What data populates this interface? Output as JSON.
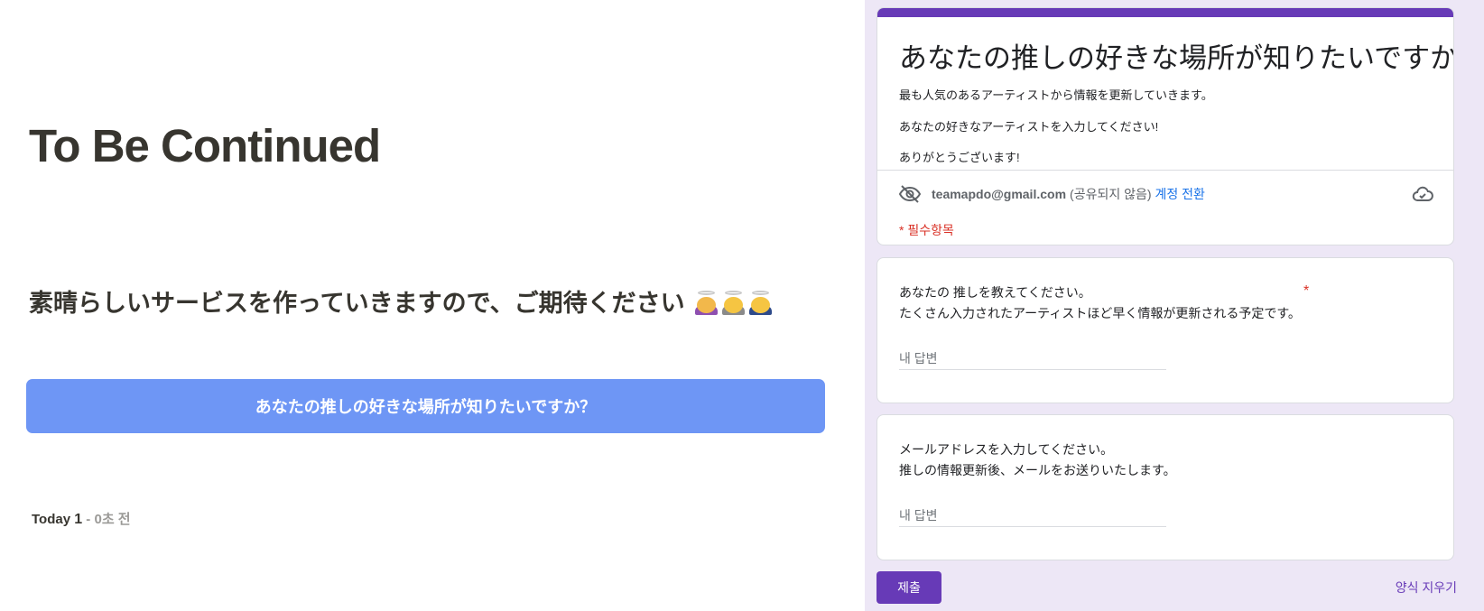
{
  "left": {
    "title": "To Be Continued",
    "subtitle": "素晴らしいサービスを作っていきますので、ご期待ください",
    "emojis": [
      "woman-pouting-icon",
      "person-bowing-icon",
      "man-bowing-icon"
    ],
    "cta_label": "あなたの推しの好きな場所が知りたいですか？",
    "counter": {
      "label": "Today",
      "count": "1",
      "sep": " - ",
      "elapsed": "0초 전"
    }
  },
  "form": {
    "accent_color": "#673ab7",
    "title": "あなたの推しの好きな場所が知りたいですか？",
    "description": [
      "最も人気のあるアーティストから情報を更新していきます。",
      "あなたの好きなアーティストを入力してください!",
      "ありがとうございます!"
    ],
    "account": {
      "email": "teamapdo@gmail.com",
      "not_shared": "(공유되지 않음)",
      "switch_label": "계정 전환"
    },
    "required_note": "* 필수항목",
    "questions": [
      {
        "lines": [
          "あなたの 推しを教えてください。",
          "たくさん入力されたアーティストほど早く情報が更新される予定です。"
        ],
        "required_mark": "*",
        "placeholder": "내 답변"
      },
      {
        "lines": [
          "メールアドレスを入力してください。",
          "推しの情報更新後、メールをお送りいたします。"
        ],
        "placeholder": "내 답변"
      }
    ],
    "submit_label": "제출",
    "clear_label": "양식 지우기"
  }
}
